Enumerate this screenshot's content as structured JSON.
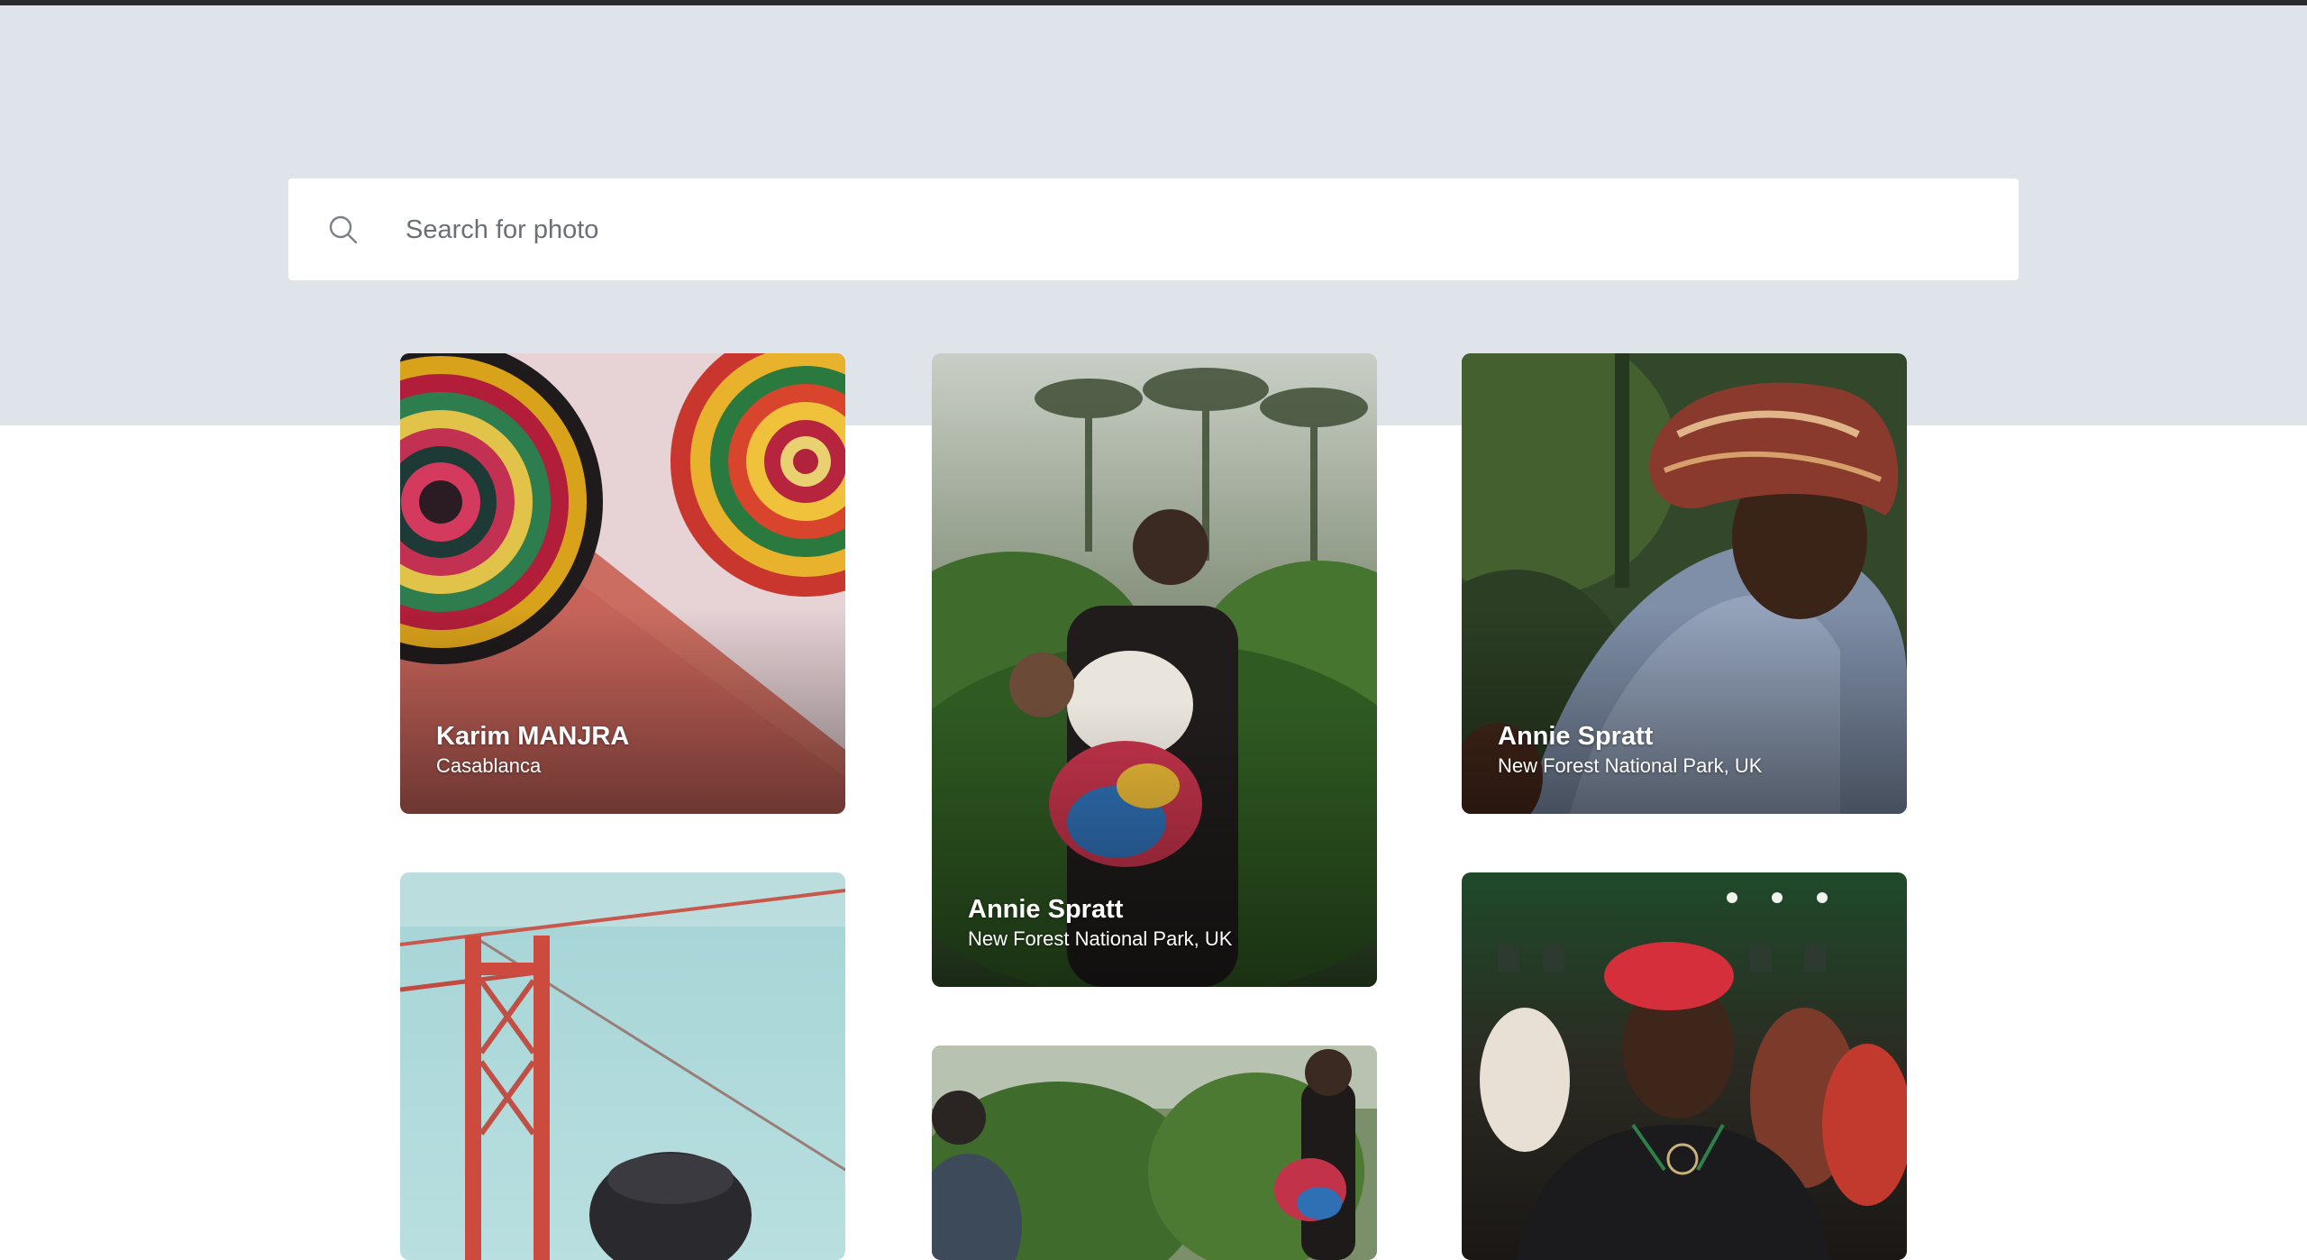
{
  "search": {
    "placeholder": "Search for photo",
    "icon": "search-icon"
  },
  "photos": [
    {
      "name": "Karim MANJRA",
      "location": "Casablanca",
      "subject": "woven-wall-baskets"
    },
    {
      "name": "Annie Spratt",
      "location": "New Forest National Park, UK",
      "subject": "mother-carrying-baby-in-forest"
    },
    {
      "name": "Annie Spratt",
      "location": "New Forest National Park, UK",
      "subject": "woman-with-headwrap"
    },
    {
      "name": "",
      "location": "",
      "subject": "red-suspension-bridge"
    },
    {
      "name": "",
      "location": "",
      "subject": "people-walking-in-forest"
    },
    {
      "name": "",
      "location": "",
      "subject": "woman-in-red-beret-at-concert"
    }
  ],
  "colors": {
    "hero_background": "#dfe3ea",
    "top_border": "#2b2b2d",
    "page_background": "#ffffff"
  }
}
